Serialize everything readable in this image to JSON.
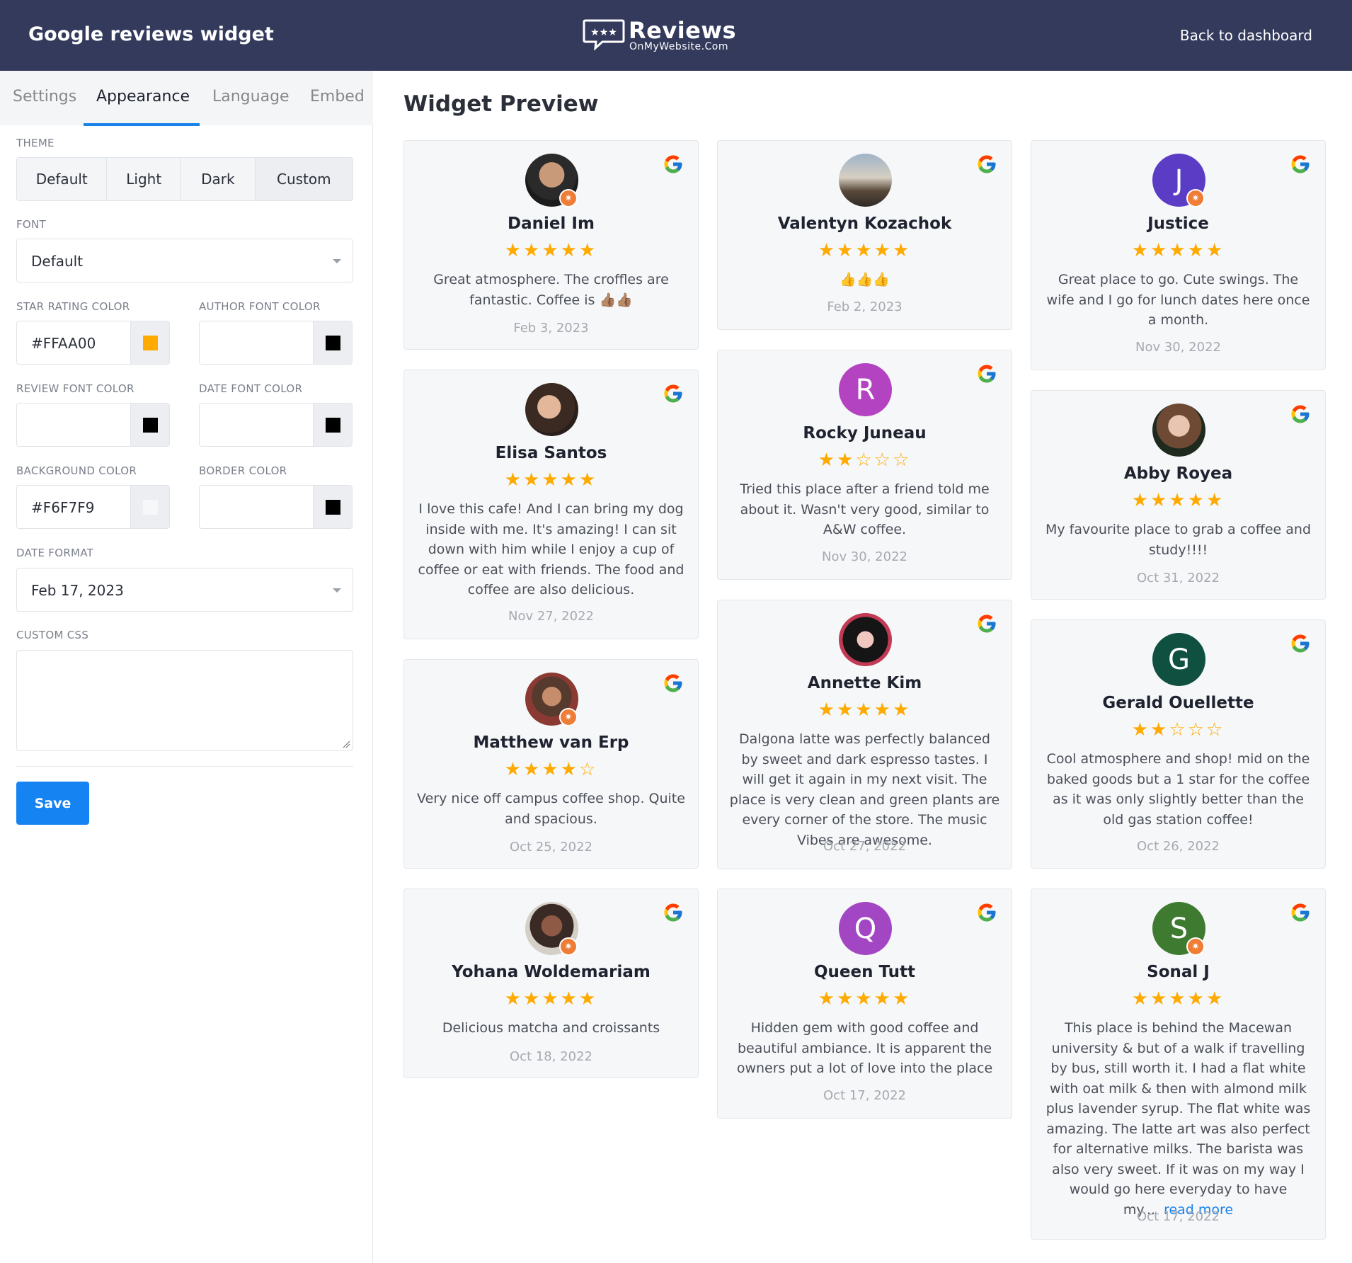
{
  "header": {
    "title": "Google reviews widget",
    "logo_main": "Reviews",
    "logo_sub": "OnMyWebsite.Com",
    "back_label": "Back to dashboard"
  },
  "tabs": [
    {
      "label": "Settings",
      "active": false
    },
    {
      "label": "Appearance",
      "active": true
    },
    {
      "label": "Language",
      "active": false
    },
    {
      "label": "Embed",
      "active": false
    }
  ],
  "settings": {
    "theme_label": "THEME",
    "themes": [
      "Default",
      "Light",
      "Dark",
      "Custom"
    ],
    "selected_theme": "Custom",
    "font_label": "FONT",
    "font_value": "Default",
    "star_color_label": "STAR RATING COLOR",
    "star_color_value": "#FFAA00",
    "author_color_label": "AUTHOR FONT COLOR",
    "author_color_value": "",
    "review_color_label": "REVIEW FONT COLOR",
    "review_color_value": "",
    "date_color_label": "DATE FONT COLOR",
    "date_color_value": "",
    "bg_color_label": "BACKGROUND COLOR",
    "bg_color_value": "#F6F7F9",
    "border_color_label": "BORDER COLOR",
    "border_color_value": "",
    "date_format_label": "DATE FORMAT",
    "date_format_value": "Feb 17, 2023",
    "custom_css_label": "CUSTOM CSS",
    "custom_css_value": "",
    "save_label": "Save"
  },
  "swatches": {
    "star": "#FFAA00",
    "author": "#000000",
    "review": "#000000",
    "date": "#000000",
    "background": "#F6F7F9",
    "border": "#000000"
  },
  "preview": {
    "title": "Widget Preview",
    "reviews": [
      {
        "name": "Daniel Im",
        "rating": 5,
        "stars": "★★★★★",
        "text": "Great atmosphere. The croffles are fantastic. Coffee is 👍🏽👍🏽",
        "date": "Feb 3, 2023",
        "avatar": "photo"
      },
      {
        "name": "Valentyn Kozachok",
        "rating": 5,
        "stars": "★★★★★",
        "text": "👍👍👍",
        "date": "Feb 2, 2023",
        "avatar": "photo"
      },
      {
        "name": "Justice",
        "rating": 5,
        "stars": "★★★★★",
        "text": "Great place to go. Cute swings. The wife and I go for lunch dates here once a month.",
        "date": "Nov 30, 2022",
        "avatar": "J"
      },
      {
        "name": "Elisa Santos",
        "rating": 5,
        "stars": "★★★★★",
        "text": "I love this cafe! And I can bring my dog inside with me. It's amazing! I can sit down with him while I enjoy a cup of coffee or eat with friends. The food and coffee are also delicious.",
        "date": "Nov 27, 2022",
        "avatar": "photo"
      },
      {
        "name": "Rocky Juneau",
        "rating": 2,
        "stars": "★★☆☆☆",
        "text": "Tried this place after a friend told me about it. Wasn't very good, similar to A&W coffee.",
        "date": "Nov 30, 2022",
        "avatar": "R"
      },
      {
        "name": "Abby Royea",
        "rating": 5,
        "stars": "★★★★★",
        "text": "My favourite place to grab a coffee and study!!!!",
        "date": "Oct 31, 2022",
        "avatar": "photo"
      },
      {
        "name": "Matthew van Erp",
        "rating": 4,
        "stars": "★★★★☆",
        "text": "Very nice off campus coffee shop. Quite and spacious.",
        "date": "Oct 25, 2022",
        "avatar": "photo"
      },
      {
        "name": "Annette Kim",
        "rating": 5,
        "stars": "★★★★★",
        "text": "Dalgona latte was perfectly balanced by sweet and dark espresso tastes. I will get it again in my next visit. The place is very clean and green plants are every corner of the store. The music Vibes are awesome.",
        "date": "Oct 27, 2022",
        "avatar": "photo"
      },
      {
        "name": "Gerald Ouellette",
        "rating": 2,
        "stars": "★★☆☆☆",
        "text": "Cool atmosphere and shop! mid on the baked goods but a 1 star for the coffee as it was only slightly better than the old gas station coffee!",
        "date": "Oct 26, 2022",
        "avatar": "G"
      },
      {
        "name": "Yohana Woldemariam",
        "rating": 5,
        "stars": "★★★★★",
        "text": "Delicious matcha and croissants",
        "date": "Oct 18, 2022",
        "avatar": "photo"
      },
      {
        "name": "Queen Tutt",
        "rating": 5,
        "stars": "★★★★★",
        "text": "Hidden gem with good coffee and beautiful ambiance. It is apparent the owners put a lot of love into the place",
        "date": "Oct 17, 2022",
        "avatar": "Q"
      },
      {
        "name": "Sonal J",
        "rating": 5,
        "stars": "★★★★★",
        "text": "This place is behind the Macewan university & but of a walk if travelling by bus, still worth it. I had a flat white with oat milk & then with almond milk plus lavender syrup. The flat white was amazing. The latte art was also perfect for alternative milks. The barista was also very sweet. If it was on my way I would go here everyday to have my...",
        "read_more": "read more",
        "date": "Oct 17, 2022",
        "avatar": "S"
      }
    ]
  },
  "avatar_colors": {
    "J": "#5b3cc4",
    "R": "#b443c2",
    "G": "#0f5040",
    "Q": "#a346c4",
    "S": "#3e7b30"
  }
}
